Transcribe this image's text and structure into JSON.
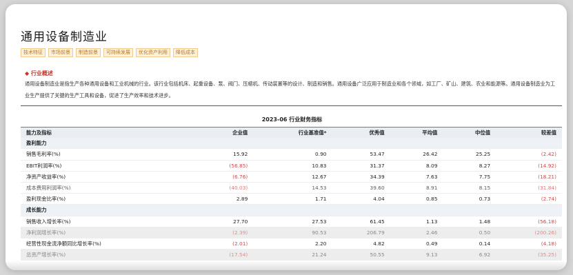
{
  "title": "通用设备制造业",
  "tags": [
    "技术特征",
    "市场前景",
    "制造前景",
    "可持续发展",
    "优化资产利用",
    "降低成本"
  ],
  "overview": {
    "heading": "◆ 行业概述",
    "text": "通用设备制造业是指生产各种通用设备和工业机械的行业。该行业包括机床、起重设备、泵、阀门、压缩机、传动装置等的设计、制造和销售。通用设备广泛应用于制造业和各个领域，如工厂、矿山、建筑、农业和能源等。通用设备制造业为工业生产提供了关键的生产工具和设备，促进了生产效率和技术进步。"
  },
  "table": {
    "title": "2023-06 行业财务指标",
    "headers": [
      "能力及指标",
      "企业值",
      "行业基准值*",
      "优秀值",
      "平均值",
      "中位值",
      "较差值"
    ],
    "rows": [
      [
        "盈利能力",
        "",
        "",
        "",
        "",
        "",
        ""
      ],
      [
        "销售毛利率(%)",
        "15.92",
        "0.90",
        "53.47",
        "26.42",
        "25.25",
        "(2.42)"
      ],
      [
        "EBIT利润率(%)",
        "(56.85)",
        "10.83",
        "31.37",
        "8.09",
        "8.27",
        "(14.92)"
      ],
      [
        "净资产收益率(%)",
        "(6.76)",
        "12.67",
        "34.39",
        "7.63",
        "7.75",
        "(18.21)"
      ],
      [
        "成本费用利润率(%)",
        "(40.03)",
        "14.53",
        "39.60",
        "8.91",
        "8.15",
        "(31.84)"
      ],
      [
        "盈利现金比率(%)",
        "2.89",
        "1.71",
        "4.04",
        "0.85",
        "0.73",
        "(2.74)"
      ],
      [
        "成长能力",
        "",
        "",
        "",
        "",
        "",
        ""
      ],
      [
        "销售收入增长率(%)",
        "27.70",
        "27.53",
        "61.45",
        "1.13",
        "1.48",
        "(56.18)"
      ],
      [
        "净利润增长率(%)",
        "(2.39)",
        "90.53",
        "206.79",
        "2.46",
        "0.50",
        "(200.26)"
      ],
      [
        "经营性现金流净额同比增长率(%)",
        "(2.01)",
        "2.20",
        "4.82",
        "0.49",
        "0.14",
        "(4.18)"
      ],
      [
        "总资产增长率(%)",
        "(17.54)",
        "21.24",
        "50.55",
        "9.13",
        "6.92",
        "(35.25)"
      ]
    ]
  }
}
